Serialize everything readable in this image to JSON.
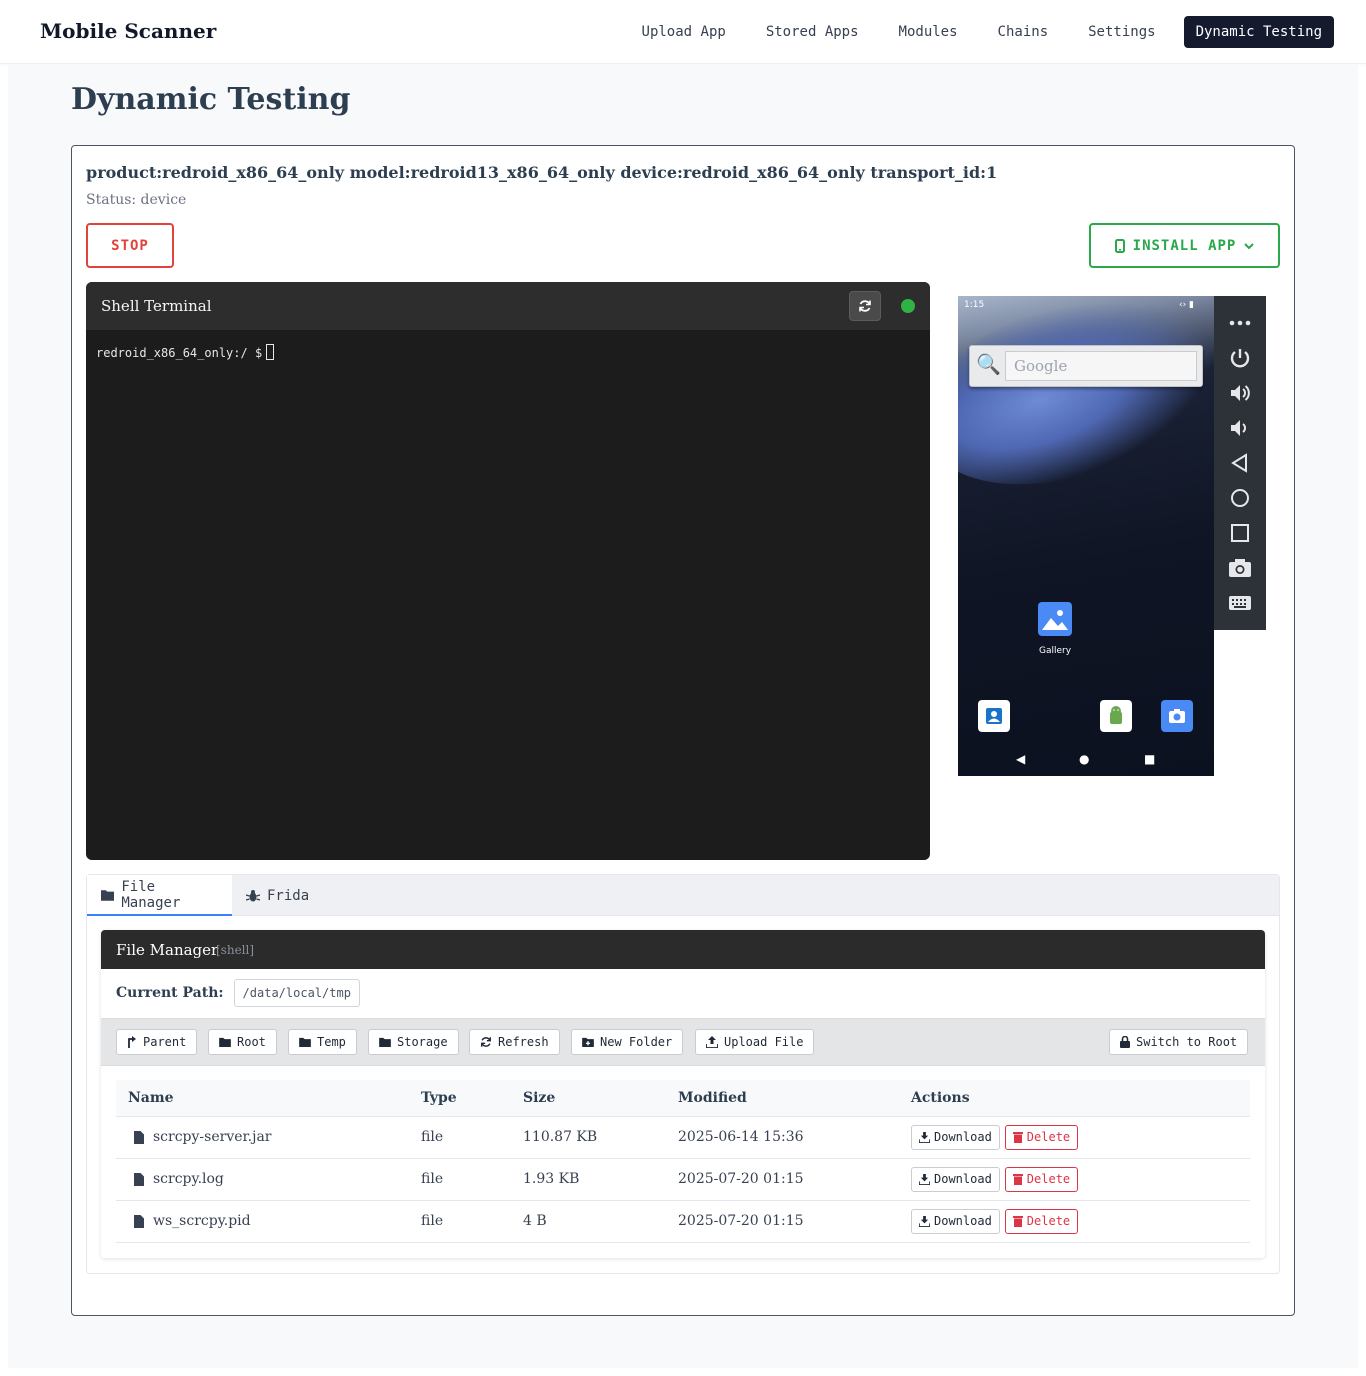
{
  "app": {
    "brand": "Mobile Scanner"
  },
  "nav": {
    "items": [
      {
        "label": "Upload App"
      },
      {
        "label": "Stored Apps"
      },
      {
        "label": "Modules"
      },
      {
        "label": "Chains"
      },
      {
        "label": "Settings"
      },
      {
        "label": "Dynamic Testing",
        "active": true
      }
    ]
  },
  "page": {
    "title": "Dynamic Testing"
  },
  "device": {
    "info": "product:redroid_x86_64_only model:redroid13_x86_64_only device:redroid_x86_64_only transport_id:1",
    "status": "Status: device",
    "stop_label": "STOP",
    "install_label": "INSTALL APP"
  },
  "terminal": {
    "title": "Shell Terminal",
    "prompt": "redroid_x86_64_only:/ $",
    "connected_color": "#2fb344"
  },
  "phone": {
    "time": "1:15",
    "search_placeholder": "Google",
    "gallery_label": "Gallery"
  },
  "tabs": [
    {
      "label": "File Manager",
      "icon": "folder-icon",
      "active": true
    },
    {
      "label": "Frida",
      "icon": "bug-icon"
    }
  ],
  "file_manager": {
    "title": "File Manager",
    "mode": "[shell]",
    "path_label": "Current Path:",
    "path": "/data/local/tmp",
    "buttons": {
      "parent": "Parent",
      "root": "Root",
      "temp": "Temp",
      "storage": "Storage",
      "refresh": "Refresh",
      "new_folder": "New Folder",
      "upload": "Upload File",
      "switch_root": "Switch to Root"
    },
    "columns": [
      "Name",
      "Type",
      "Size",
      "Modified",
      "Actions"
    ],
    "rows": [
      {
        "name": "scrcpy-server.jar",
        "type": "file",
        "size": "110.87 KB",
        "modified": "2025-06-14 15:36"
      },
      {
        "name": "scrcpy.log",
        "type": "file",
        "size": "1.93 KB",
        "modified": "2025-07-20 01:15"
      },
      {
        "name": "ws_scrcpy.pid",
        "type": "file",
        "size": "4 B",
        "modified": "2025-07-20 01:15"
      }
    ],
    "download_label": "Download",
    "delete_label": "Delete"
  }
}
